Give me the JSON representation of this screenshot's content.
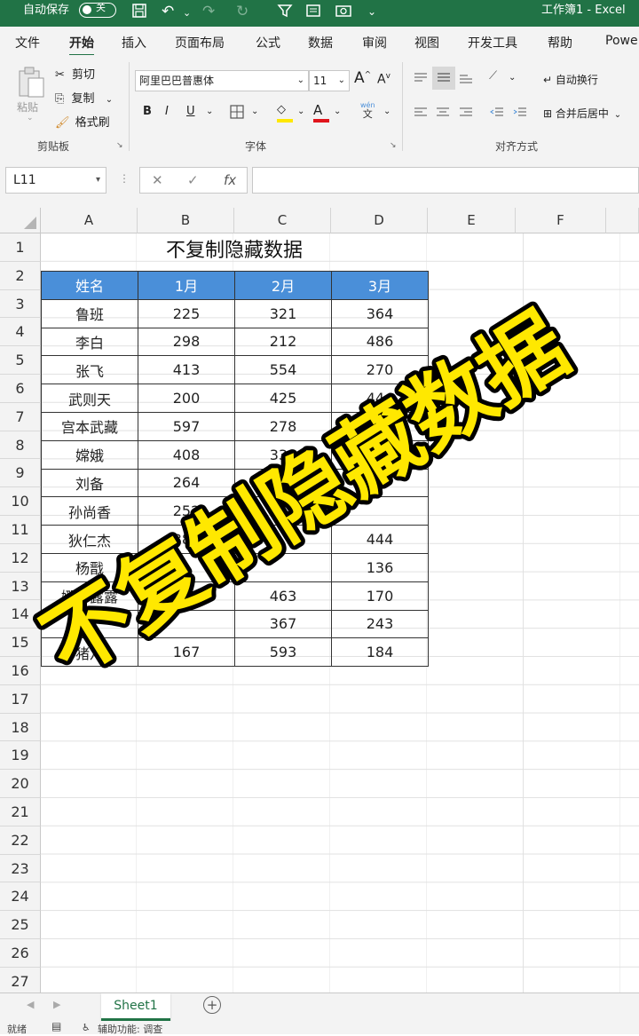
{
  "titlebar": {
    "autosave_label": "自动保存",
    "autosave_state": "关",
    "doc_title": "工作簿1 - Excel",
    "accent_color": "#217346"
  },
  "tabs": [
    "文件",
    "开始",
    "插入",
    "页面布局",
    "公式",
    "数据",
    "审阅",
    "视图",
    "开发工具",
    "帮助",
    "Powe"
  ],
  "active_tab": "开始",
  "ribbon": {
    "clipboard": {
      "paste_label": "粘贴",
      "cut_label": "剪切",
      "copy_label": "复制",
      "format_painter_label": "格式刷",
      "group_label": "剪贴板"
    },
    "font": {
      "font_name": "阿里巴巴普惠体",
      "font_size": "11",
      "grow_label": "A",
      "shrink_label": "A",
      "bold_label": "B",
      "italic_label": "I",
      "underline_label": "U",
      "fill_label": "A",
      "color_label": "A",
      "wen_label": "wén",
      "wen_char": "文",
      "group_label": "字体"
    },
    "alignment": {
      "wrap_label": "自动换行",
      "merge_label": "合并后居中",
      "group_label": "对齐方式"
    }
  },
  "formula_bar": {
    "name_box": "L11",
    "cancel_icon": "✕",
    "enter_icon": "✓",
    "fx_label": "fx",
    "formula_value": ""
  },
  "columns": [
    "A",
    "B",
    "C",
    "D",
    "E",
    "F"
  ],
  "rows": [
    "1",
    "2",
    "3",
    "4",
    "5",
    "6",
    "7",
    "8",
    "9",
    "10",
    "11",
    "12",
    "13",
    "14",
    "15",
    "16",
    "17",
    "18",
    "19",
    "20",
    "21",
    "22",
    "23",
    "24",
    "25",
    "26",
    "27"
  ],
  "sheet": {
    "title": "不复制隐藏数据",
    "headers": [
      "姓名",
      "1月",
      "2月",
      "3月"
    ],
    "header_color": "#4a8fd9",
    "data": [
      [
        "鲁班",
        "225",
        "321",
        "364"
      ],
      [
        "李白",
        "298",
        "212",
        "486"
      ],
      [
        "张飞",
        "413",
        "554",
        "270"
      ],
      [
        "武则天",
        "200",
        "425",
        "444"
      ],
      [
        "宫本武藏",
        "597",
        "278",
        "416"
      ],
      [
        "嫦娥",
        "408",
        "330",
        ""
      ],
      [
        "刘备",
        "264",
        "440",
        ""
      ],
      [
        "孙尚香",
        "252",
        "",
        ""
      ],
      [
        "狄仁杰",
        "381",
        "",
        "444"
      ],
      [
        "杨戬",
        "",
        "",
        "136"
      ],
      [
        "娜可露露",
        "",
        "463",
        "170"
      ],
      [
        "百",
        "",
        "367",
        "243"
      ],
      [
        "猪八",
        "167",
        "593",
        "184"
      ]
    ]
  },
  "overlay_text": "不复制隐藏数据",
  "overlay_color": "#ffe800",
  "sheet_tabs": [
    "Sheet1"
  ],
  "status": {
    "ready": "就绪",
    "accessibility": "辅助功能: 调查"
  }
}
